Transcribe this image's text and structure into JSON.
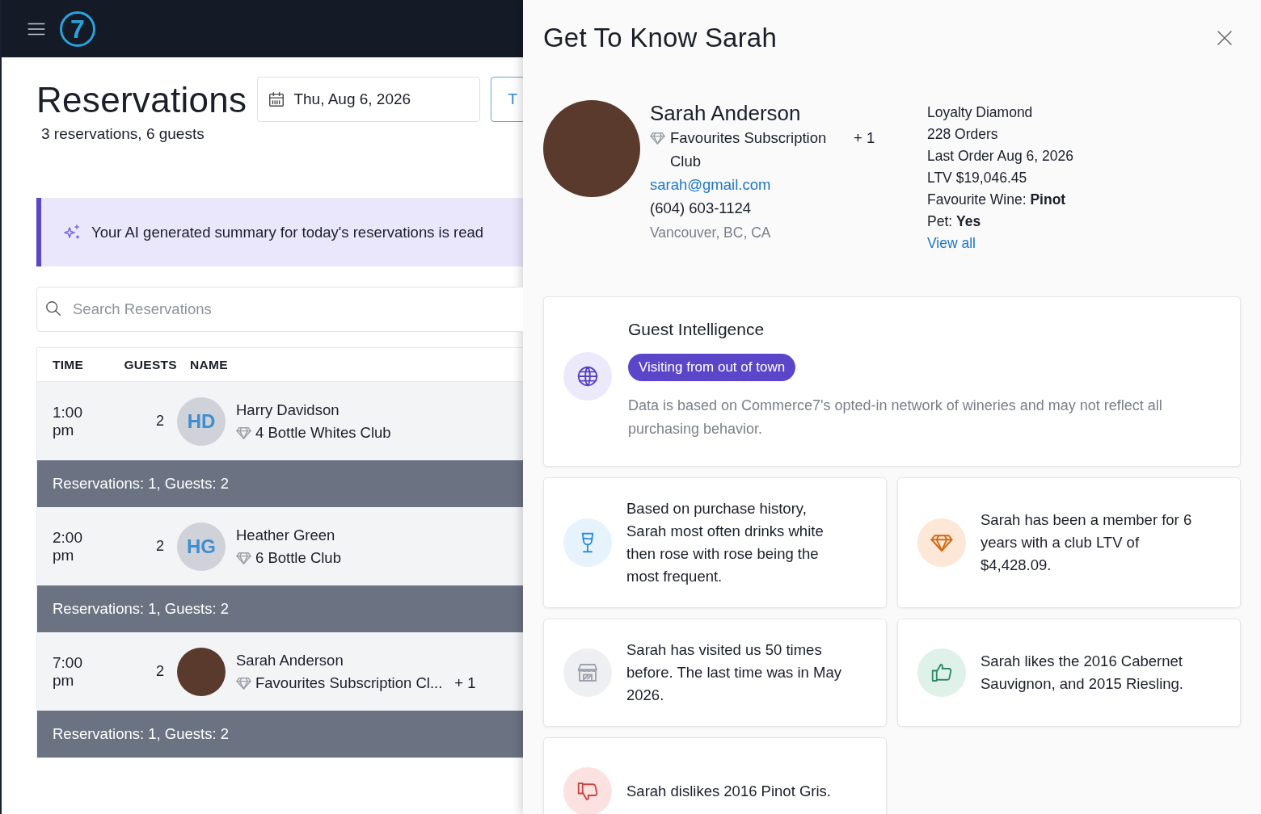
{
  "topbar": {
    "logo": "7"
  },
  "page": {
    "title": "Reservations",
    "subtitle": "3 reservations, 6 guests",
    "date": "Thu, Aug 6, 2026",
    "button_partial": "T"
  },
  "ai_banner": {
    "text": "Your AI generated summary for today's reservations is read"
  },
  "search": {
    "placeholder": "Search Reservations"
  },
  "table": {
    "columns": [
      "TIME",
      "GUESTS",
      "NAME"
    ],
    "groups": [
      {
        "rows": [
          {
            "time": "1:00 pm",
            "guests": "2",
            "kind": "initials",
            "initials": "HD",
            "name": "Harry Davidson",
            "club": "4 Bottle Whites Club"
          }
        ],
        "summary": "Reservations: 1, Guests: 2"
      },
      {
        "rows": [
          {
            "time": "2:00 pm",
            "guests": "2",
            "kind": "initials",
            "initials": "HG",
            "name": "Heather Green",
            "club": "6 Bottle Club"
          }
        ],
        "summary": "Reservations: 1, Guests: 2"
      },
      {
        "rows": [
          {
            "time": "7:00 pm",
            "guests": "2",
            "kind": "photo",
            "name": "Sarah Anderson",
            "club": "Favourites Subscription Cl...",
            "extra": "+ 1"
          }
        ],
        "summary": "Reservations: 1, Guests: 2"
      }
    ]
  },
  "drawer": {
    "title": "Get To Know Sarah",
    "profile": {
      "name": "Sarah Anderson",
      "club": "Favourites Subscription Club",
      "club_extra": "+ 1",
      "email": "sarah@gmail.com",
      "phone": "(604) 603-1124",
      "location": "Vancouver, BC, CA"
    },
    "stats": [
      "Loyalty Diamond",
      "228 Orders",
      "Last Order Aug 6, 2026",
      "LTV  $19,046.45",
      "Favourite Wine: **Pinot**",
      "Pet: **Yes**"
    ],
    "view_all": "View all",
    "intelligence": {
      "title": "Guest Intelligence",
      "tag": "Visiting from out of town",
      "note": "Data is based on Commerce7's opted-in network of wineries and may not reflect all purchasing behavior."
    },
    "insights": [
      {
        "kind": "wine",
        "text": "Based on purchase history, Sarah most often drinks white then rose with rose being the most frequent."
      },
      {
        "kind": "diamond",
        "text": "Sarah has been a member for 6 years with a club LTV of $4,428.09."
      },
      {
        "kind": "store",
        "text": "Sarah has visited us 50 times before. The last time was in May 2026."
      },
      {
        "kind": "like",
        "text": "Sarah likes the 2016 Cabernet Sauvignon, and 2015 Riesling."
      },
      {
        "kind": "dislike",
        "text": "Sarah dislikes 2016 Pinot Gris."
      }
    ]
  }
}
